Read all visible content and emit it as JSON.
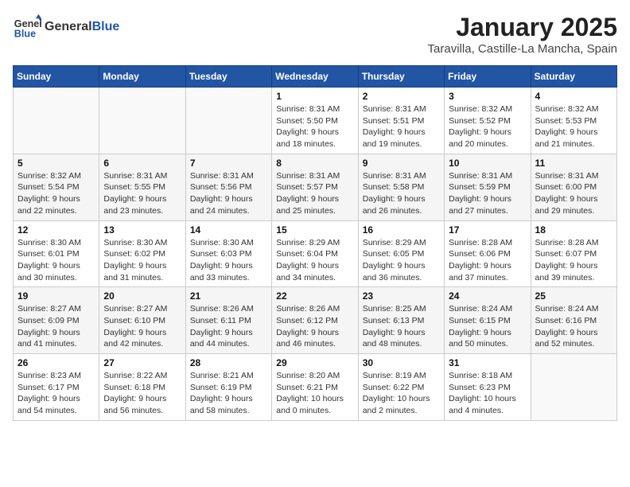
{
  "header": {
    "logo_general": "General",
    "logo_blue": "Blue",
    "month": "January 2025",
    "location": "Taravilla, Castille-La Mancha, Spain"
  },
  "weekdays": [
    "Sunday",
    "Monday",
    "Tuesday",
    "Wednesday",
    "Thursday",
    "Friday",
    "Saturday"
  ],
  "weeks": [
    [
      {
        "day": "",
        "sunrise": "",
        "sunset": "",
        "daylight": ""
      },
      {
        "day": "",
        "sunrise": "",
        "sunset": "",
        "daylight": ""
      },
      {
        "day": "",
        "sunrise": "",
        "sunset": "",
        "daylight": ""
      },
      {
        "day": "1",
        "sunrise": "Sunrise: 8:31 AM",
        "sunset": "Sunset: 5:50 PM",
        "daylight": "Daylight: 9 hours and 18 minutes."
      },
      {
        "day": "2",
        "sunrise": "Sunrise: 8:31 AM",
        "sunset": "Sunset: 5:51 PM",
        "daylight": "Daylight: 9 hours and 19 minutes."
      },
      {
        "day": "3",
        "sunrise": "Sunrise: 8:32 AM",
        "sunset": "Sunset: 5:52 PM",
        "daylight": "Daylight: 9 hours and 20 minutes."
      },
      {
        "day": "4",
        "sunrise": "Sunrise: 8:32 AM",
        "sunset": "Sunset: 5:53 PM",
        "daylight": "Daylight: 9 hours and 21 minutes."
      }
    ],
    [
      {
        "day": "5",
        "sunrise": "Sunrise: 8:32 AM",
        "sunset": "Sunset: 5:54 PM",
        "daylight": "Daylight: 9 hours and 22 minutes."
      },
      {
        "day": "6",
        "sunrise": "Sunrise: 8:31 AM",
        "sunset": "Sunset: 5:55 PM",
        "daylight": "Daylight: 9 hours and 23 minutes."
      },
      {
        "day": "7",
        "sunrise": "Sunrise: 8:31 AM",
        "sunset": "Sunset: 5:56 PM",
        "daylight": "Daylight: 9 hours and 24 minutes."
      },
      {
        "day": "8",
        "sunrise": "Sunrise: 8:31 AM",
        "sunset": "Sunset: 5:57 PM",
        "daylight": "Daylight: 9 hours and 25 minutes."
      },
      {
        "day": "9",
        "sunrise": "Sunrise: 8:31 AM",
        "sunset": "Sunset: 5:58 PM",
        "daylight": "Daylight: 9 hours and 26 minutes."
      },
      {
        "day": "10",
        "sunrise": "Sunrise: 8:31 AM",
        "sunset": "Sunset: 5:59 PM",
        "daylight": "Daylight: 9 hours and 27 minutes."
      },
      {
        "day": "11",
        "sunrise": "Sunrise: 8:31 AM",
        "sunset": "Sunset: 6:00 PM",
        "daylight": "Daylight: 9 hours and 29 minutes."
      }
    ],
    [
      {
        "day": "12",
        "sunrise": "Sunrise: 8:30 AM",
        "sunset": "Sunset: 6:01 PM",
        "daylight": "Daylight: 9 hours and 30 minutes."
      },
      {
        "day": "13",
        "sunrise": "Sunrise: 8:30 AM",
        "sunset": "Sunset: 6:02 PM",
        "daylight": "Daylight: 9 hours and 31 minutes."
      },
      {
        "day": "14",
        "sunrise": "Sunrise: 8:30 AM",
        "sunset": "Sunset: 6:03 PM",
        "daylight": "Daylight: 9 hours and 33 minutes."
      },
      {
        "day": "15",
        "sunrise": "Sunrise: 8:29 AM",
        "sunset": "Sunset: 6:04 PM",
        "daylight": "Daylight: 9 hours and 34 minutes."
      },
      {
        "day": "16",
        "sunrise": "Sunrise: 8:29 AM",
        "sunset": "Sunset: 6:05 PM",
        "daylight": "Daylight: 9 hours and 36 minutes."
      },
      {
        "day": "17",
        "sunrise": "Sunrise: 8:28 AM",
        "sunset": "Sunset: 6:06 PM",
        "daylight": "Daylight: 9 hours and 37 minutes."
      },
      {
        "day": "18",
        "sunrise": "Sunrise: 8:28 AM",
        "sunset": "Sunset: 6:07 PM",
        "daylight": "Daylight: 9 hours and 39 minutes."
      }
    ],
    [
      {
        "day": "19",
        "sunrise": "Sunrise: 8:27 AM",
        "sunset": "Sunset: 6:09 PM",
        "daylight": "Daylight: 9 hours and 41 minutes."
      },
      {
        "day": "20",
        "sunrise": "Sunrise: 8:27 AM",
        "sunset": "Sunset: 6:10 PM",
        "daylight": "Daylight: 9 hours and 42 minutes."
      },
      {
        "day": "21",
        "sunrise": "Sunrise: 8:26 AM",
        "sunset": "Sunset: 6:11 PM",
        "daylight": "Daylight: 9 hours and 44 minutes."
      },
      {
        "day": "22",
        "sunrise": "Sunrise: 8:26 AM",
        "sunset": "Sunset: 6:12 PM",
        "daylight": "Daylight: 9 hours and 46 minutes."
      },
      {
        "day": "23",
        "sunrise": "Sunrise: 8:25 AM",
        "sunset": "Sunset: 6:13 PM",
        "daylight": "Daylight: 9 hours and 48 minutes."
      },
      {
        "day": "24",
        "sunrise": "Sunrise: 8:24 AM",
        "sunset": "Sunset: 6:15 PM",
        "daylight": "Daylight: 9 hours and 50 minutes."
      },
      {
        "day": "25",
        "sunrise": "Sunrise: 8:24 AM",
        "sunset": "Sunset: 6:16 PM",
        "daylight": "Daylight: 9 hours and 52 minutes."
      }
    ],
    [
      {
        "day": "26",
        "sunrise": "Sunrise: 8:23 AM",
        "sunset": "Sunset: 6:17 PM",
        "daylight": "Daylight: 9 hours and 54 minutes."
      },
      {
        "day": "27",
        "sunrise": "Sunrise: 8:22 AM",
        "sunset": "Sunset: 6:18 PM",
        "daylight": "Daylight: 9 hours and 56 minutes."
      },
      {
        "day": "28",
        "sunrise": "Sunrise: 8:21 AM",
        "sunset": "Sunset: 6:19 PM",
        "daylight": "Daylight: 9 hours and 58 minutes."
      },
      {
        "day": "29",
        "sunrise": "Sunrise: 8:20 AM",
        "sunset": "Sunset: 6:21 PM",
        "daylight": "Daylight: 10 hours and 0 minutes."
      },
      {
        "day": "30",
        "sunrise": "Sunrise: 8:19 AM",
        "sunset": "Sunset: 6:22 PM",
        "daylight": "Daylight: 10 hours and 2 minutes."
      },
      {
        "day": "31",
        "sunrise": "Sunrise: 8:18 AM",
        "sunset": "Sunset: 6:23 PM",
        "daylight": "Daylight: 10 hours and 4 minutes."
      },
      {
        "day": "",
        "sunrise": "",
        "sunset": "",
        "daylight": ""
      }
    ]
  ]
}
